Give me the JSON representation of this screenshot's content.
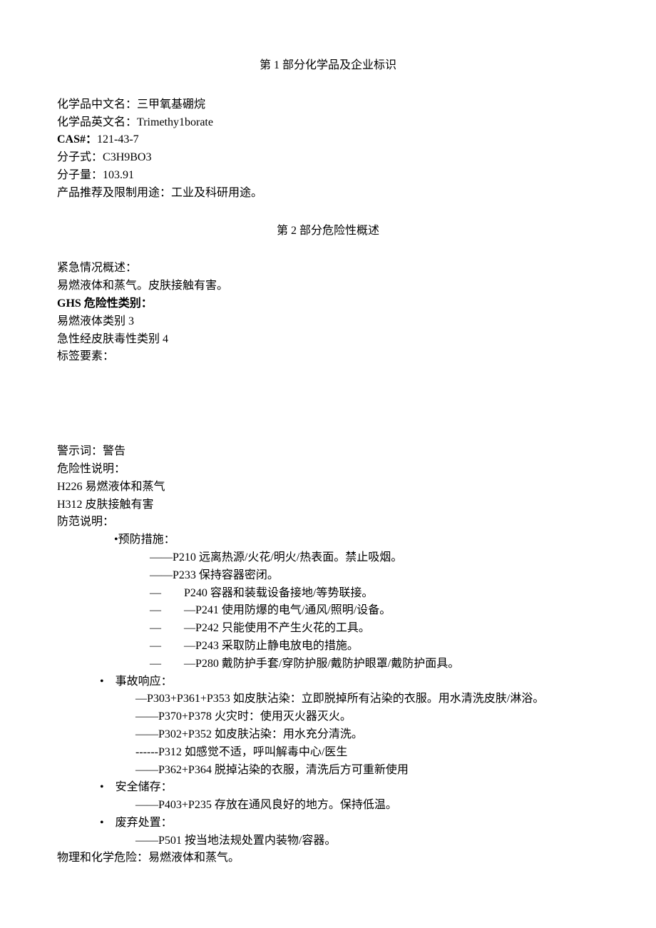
{
  "section1": {
    "title": "第 1 部分化学品及企业标识",
    "rows": {
      "zh_name_label": "化学品中文名：",
      "zh_name_value": "三甲氧基硼烷",
      "en_name_label": "化学品英文名：",
      "en_name_value": "Trimethy1borate",
      "cas_label": "CAS#：",
      "cas_value": "121-43-7",
      "formula_label": "分子式：",
      "formula_value": "C3H9BO3",
      "mw_label": "分子量：",
      "mw_value": "103.91",
      "use_label": "产品推荐及限制用途：",
      "use_value": "工业及科研用途。"
    }
  },
  "section2": {
    "title": "第 2 部分危险性概述",
    "emergency_label": "紧急情况概述：",
    "emergency_body": "易燃液体和蒸气。皮肤接触有害。",
    "ghs_label": "GHS 危险性类别：",
    "ghs_line1": "易燃液体类别 3",
    "ghs_line2": "急性经皮肤毒性类别 4",
    "label_elements": "标签要素：",
    "signal_label": "警示词：",
    "signal_value": "警告",
    "hazard_label": "危险性说明：",
    "hazard_h226": "H226 易燃液体和蒸气",
    "hazard_h312": "H312 皮肤接触有害",
    "precaution_label": "防范说明：",
    "prevention_label": "•预防措施：",
    "prevention": {
      "p210": "——P210 远离热源/火花/明火/热表面。禁止吸烟。",
      "p233": "——P233 保持容器密闭。",
      "p240": "—  P240 容器和装载设备接地/等势联接。",
      "p241": "—  —P241 使用防爆的电气/通风/照明/设备。",
      "p242": "—  —P242 只能使用不产生火花的工具。",
      "p243": "—  —P243 采取防止静电放电的措施。",
      "p280": "—  —P280 戴防护手套/穿防护服/戴防护眼罩/戴防护面具。"
    },
    "response_label": "• 事故响应：",
    "response": {
      "r1": "—P303+P361+P353 如皮肤沾染：立即脱掉所有沾染的衣服。用水清洗皮肤/淋浴。",
      "r2": "——P370+P378 火灾时：使用灭火器灭火。",
      "r3": "——P302+P352 如皮肤沾染：用水充分清洗。",
      "r4": "------P312 如感觉不适，呼叫解毒中心/医生",
      "r5": "——P362+P364 脱掉沾染的衣服，清洗后方可重新使用"
    },
    "storage_label": "• 安全储存：",
    "storage": {
      "s1": "——P403+P235 存放在通风良好的地方。保持低温。"
    },
    "disposal_label": "• 废弃处置：",
    "disposal": {
      "d1": "——P501 按当地法规处置内装物/容器。"
    },
    "phys_label": "物理和化学危险：",
    "phys_value": "易燃液体和蒸气。"
  }
}
